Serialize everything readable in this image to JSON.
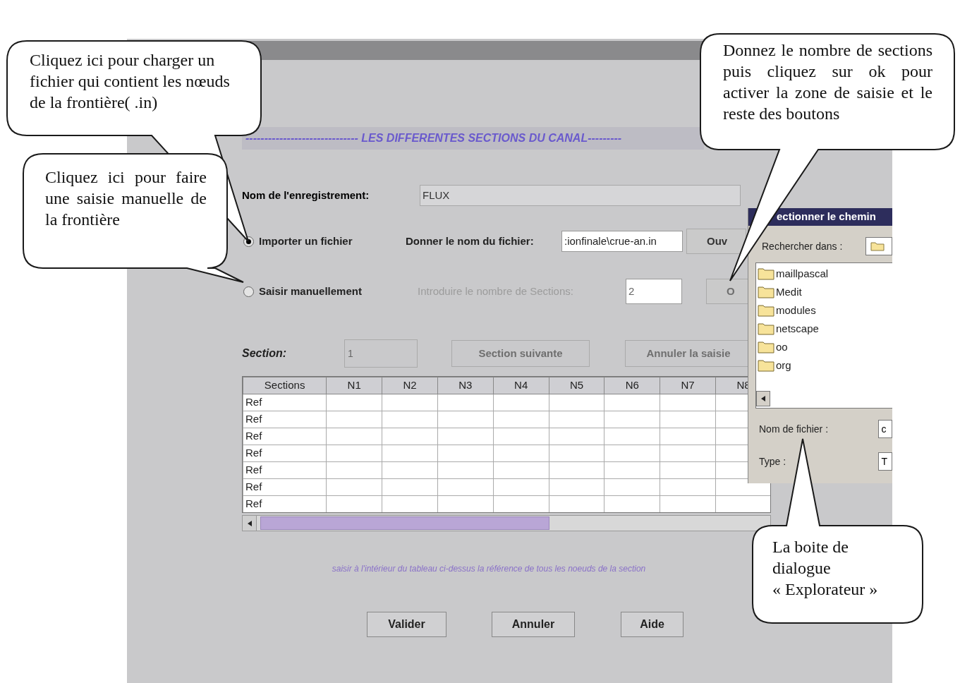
{
  "window": {
    "heading": "------------------------------ LES DIFFERENTES SECTIONS DU CANAL---------"
  },
  "record_name": {
    "label": "Nom de l'enregistrement:",
    "value": "FLUX"
  },
  "source_options": [
    {
      "label": "Importer un fichier",
      "selected": true,
      "field_label": "Donner le nom du fichier:",
      "value": ":ionfinale\\crue-an.in",
      "button": "Ouv",
      "disabled": false
    },
    {
      "label": "Saisir manuellement",
      "selected": false,
      "field_label": "Introduire le nombre de Sections:",
      "value": "2",
      "button": "O",
      "disabled": true
    }
  ],
  "section": {
    "label": "Section:",
    "value": "1",
    "disabled": true,
    "buttons": [
      {
        "label": "Section suivante",
        "disabled": true
      },
      {
        "label": "Annuler la saisie",
        "disabled": true
      }
    ]
  },
  "table": {
    "columns": [
      "Sections",
      "N1",
      "N2",
      "N3",
      "N4",
      "N5",
      "N6",
      "N7",
      "N8"
    ],
    "rows": [
      "Ref",
      "Ref",
      "Ref",
      "Ref",
      "Ref",
      "Ref",
      "Ref"
    ]
  },
  "hint": "saisir à l'intérieur du tableau ci-dessus la référence de tous les noeuds de la section",
  "buttons": [
    "Valider",
    "Annuler",
    "Aide"
  ],
  "file_dialog": {
    "title": "ectionner le chemin",
    "look_in_label": "Rechercher dans :",
    "folders": [
      "maillpascal",
      "Medit",
      "modules",
      "netscape",
      "oo",
      "org"
    ],
    "file_name_label": "Nom de fichier :",
    "file_name_value": "c",
    "type_label": "Type :",
    "type_value": "T"
  },
  "callouts": [
    "Cliquez ici pour charger un fichier qui contient les nœuds de la frontière( .in)",
    "Cliquez ici pour faire une saisie manuelle de la frontière",
    "Donnez le nombre de sections puis cliquez sur ok pour activer la zone de saisie et le reste des boutons",
    "La boite de dialogue « Explorateur »"
  ]
}
